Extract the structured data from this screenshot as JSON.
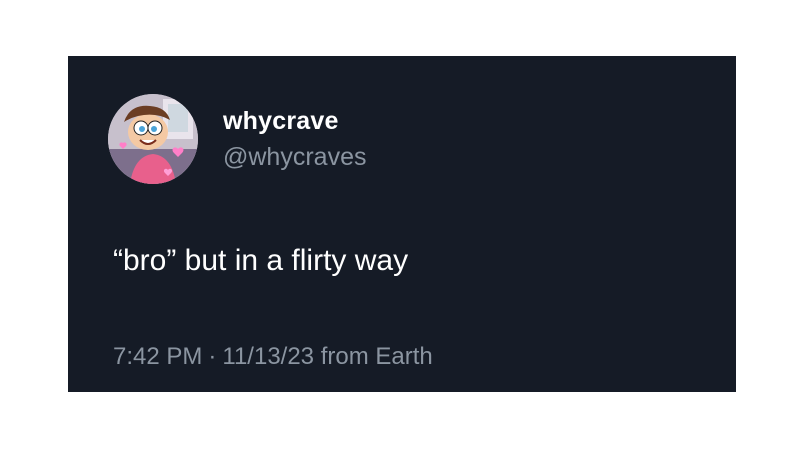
{
  "tweet": {
    "display_name": "whycrave",
    "handle": "@whycraves",
    "text": "“bro” but in a flirty way",
    "time": "7:42 PM",
    "separator": "·",
    "date": "11/13/23",
    "source": "from Earth"
  },
  "colors": {
    "card_background": "#151b26",
    "primary_text": "#ffffff",
    "secondary_text": "#8b95a1",
    "page_background": "#ffffff"
  },
  "avatar": {
    "icon": "cartoon-character-avatar"
  }
}
